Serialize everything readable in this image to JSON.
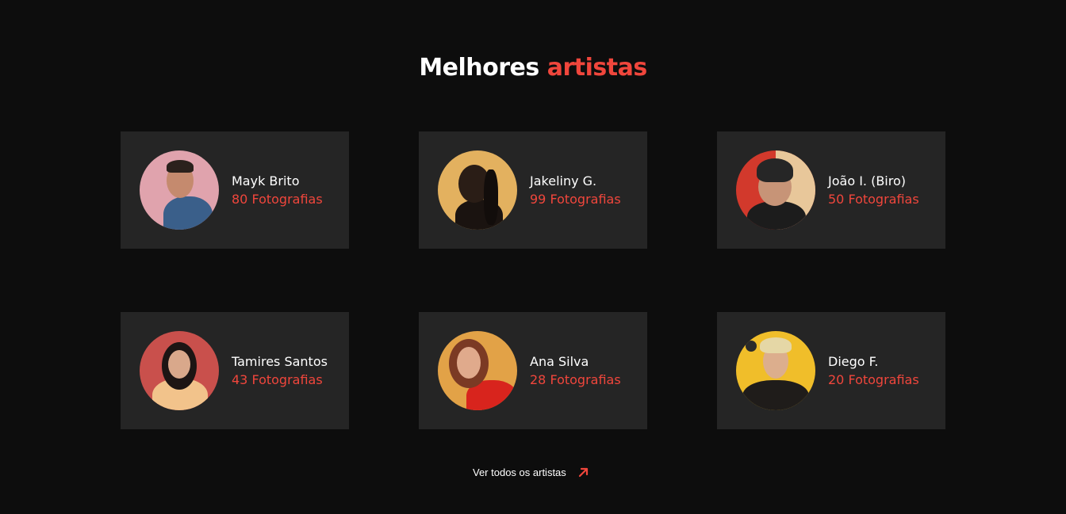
{
  "section": {
    "title_main": "Melhores",
    "title_accent": "artistas"
  },
  "colors": {
    "background": "#0d0d0d",
    "card": "#252525",
    "accent": "#f0463c",
    "text": "#ffffff"
  },
  "artists": [
    {
      "name": "Mayk Brito",
      "count": "80 Fotografias",
      "avatar_bg": "#e0a3ad"
    },
    {
      "name": "Jakeliny G.",
      "count": "99 Fotografias",
      "avatar_bg": "#e3b15f"
    },
    {
      "name": "João I. (Biro)",
      "count": "50 Fotografias",
      "avatar_bg": "#d2392c"
    },
    {
      "name": "Tamires Santos",
      "count": "43 Fotografias",
      "avatar_bg": "#c9504c"
    },
    {
      "name": "Ana Silva",
      "count": "28 Fotografias",
      "avatar_bg": "#e2a247"
    },
    {
      "name": "Diego F.",
      "count": "20 Fotografias",
      "avatar_bg": "#f0be2a"
    }
  ],
  "footer": {
    "see_all_label": "Ver todos os artistas",
    "see_all_icon": "arrow-up-right-icon"
  }
}
